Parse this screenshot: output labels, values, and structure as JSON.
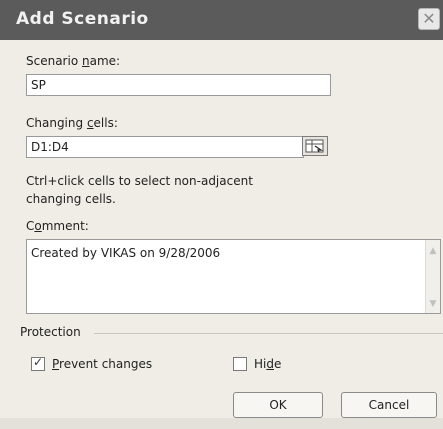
{
  "dialog": {
    "title": "Add Scenario",
    "close_glyph": "✕",
    "scenario_name": {
      "label_pre": "Scenario ",
      "label_ul": "n",
      "label_post": "ame:",
      "value": "SP"
    },
    "changing_cells": {
      "label_pre": "Changing ",
      "label_ul": "c",
      "label_post": "ells:",
      "value": "D1:D4"
    },
    "hint_line1": "Ctrl+click cells to select non-adjacent",
    "hint_line2": "changing cells.",
    "comment": {
      "label_pre": "C",
      "label_ul": "o",
      "label_post": "mment:",
      "value": "Created by VIKAS on 9/28/2006"
    },
    "protection": {
      "label": "Protection",
      "prevent_changes": {
        "label_ul": "P",
        "label_post": "revent changes",
        "checked": true
      },
      "hide": {
        "label_pre": "Hi",
        "label_ul": "d",
        "label_post": "e",
        "checked": false
      }
    },
    "ok_label": "OK",
    "cancel_label": "Cancel"
  }
}
